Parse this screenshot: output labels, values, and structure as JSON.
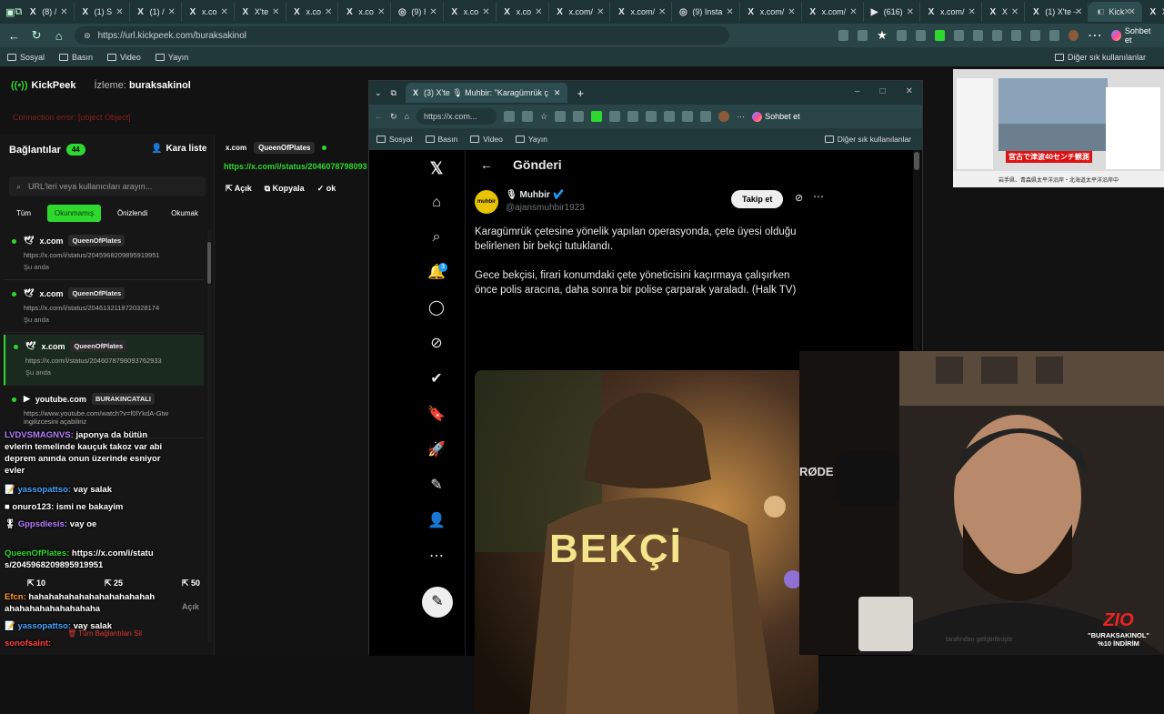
{
  "browser": {
    "tabs": [
      {
        "fav": "X",
        "label": "(8) /"
      },
      {
        "fav": "X",
        "label": "(1) S"
      },
      {
        "fav": "X",
        "label": "(1) /"
      },
      {
        "fav": "X",
        "label": "x.co"
      },
      {
        "fav": "X",
        "label": "X'te"
      },
      {
        "fav": "X",
        "label": "x.co"
      },
      {
        "fav": "X",
        "label": "x.co"
      },
      {
        "fav": "◎",
        "label": "(9) I"
      },
      {
        "fav": "X",
        "label": "x.co"
      },
      {
        "fav": "X",
        "label": "x.co"
      },
      {
        "fav": "X",
        "label": "x.com/"
      },
      {
        "fav": "X",
        "label": "x.com/"
      },
      {
        "fav": "◎",
        "label": "(9) Insta"
      },
      {
        "fav": "X",
        "label": "x.com/"
      },
      {
        "fav": "X",
        "label": "x.com/"
      },
      {
        "fav": "▶",
        "label": "(616)"
      },
      {
        "fav": "X",
        "label": "x.com/"
      },
      {
        "fav": "X",
        "label": "X"
      },
      {
        "fav": "X",
        "label": "(1) X'te"
      },
      {
        "fav": "◐",
        "label": "Kick"
      },
      {
        "fav": "X",
        "label": "X"
      }
    ],
    "url": "https://url.kickpeek.com/buraksakinol",
    "chat_label": "Sohbet et",
    "bookmarks": [
      "Sosyal",
      "Basın",
      "Video",
      "Yayın"
    ],
    "other_bookmarks": "Diğer sık kullanılanlar"
  },
  "kickpeek": {
    "logo": "KickPeek",
    "watching_label": "İzleme:",
    "watching_user": "buraksakinol",
    "error": "Connection error: [object Object]",
    "connections_title": "Bağlantılar",
    "connections_count": "44",
    "blacklist": "Kara liste",
    "search_placeholder": "URL'leri veya kullanıcıları arayın...",
    "filters": [
      "Tüm",
      "Okunmamış",
      "Önizlendi",
      "Okumak"
    ],
    "items": [
      {
        "site": "x.com",
        "user": "QueenOfPlates",
        "url": "https://x.com/i/status/2045968209895919951",
        "time": "Şu anda"
      },
      {
        "site": "x.com",
        "user": "QueenOfPlates",
        "url": "https://x.com/i/status/2046132118720328174",
        "time": "Şu anda"
      },
      {
        "site": "x.com",
        "user": "QueenOfPlates",
        "url": "https://x.com/i/status/2046078798093762933",
        "time": "Şu anda"
      },
      {
        "site": "youtube.com",
        "user": "BURAKINCATALI",
        "url": "https://www.youtube.com/watch?v=f0lYkdA-Gtw ingilizcesini açabiliriz",
        "time": ""
      }
    ],
    "bottom_counts": [
      "10",
      "25",
      "50"
    ],
    "open_label": "Açık",
    "delete_all": "Tüm Bağlantıları Sil",
    "selected": {
      "site": "x.com",
      "user": "QueenOfPlates",
      "url": "https://x.com/i/status/2046078798093",
      "open": "Açık",
      "copy": "Kopyala",
      "mark": "ok"
    }
  },
  "chat": [
    {
      "user": "LVDVSMAGNVS:",
      "color": "#b57dff",
      "msg": "japonya da bütün evlerin temelinde kauçuk takoz var abi deprem anında onun üzerinde esniyor evler"
    },
    {
      "user": "yassopattso:",
      "color": "#4aa3ff",
      "msg": "vay salak"
    },
    {
      "user": "onuro123:",
      "color": "#fff",
      "msg": "ismi ne bakayim"
    },
    {
      "user": "Gppsdiesis:",
      "color": "#b57dff",
      "msg": "vay oe"
    },
    {
      "user": "QueenOfPlates:",
      "color": "#2ed82e",
      "msg": "https://x.com/i/status/2045968209895919951"
    },
    {
      "user": "Efcn:",
      "color": "#ff9b2e",
      "msg": "hahahahahahahahahahahahahahahahahahahahahaha"
    },
    {
      "user": "yassopattso:",
      "color": "#4aa3ff",
      "msg": "vay salak"
    },
    {
      "user": "sonofsaint:",
      "color": "#ff4040",
      "msg": ""
    }
  ],
  "popup": {
    "tab_title": "(3) X'te 🎙 Muhbir: \"Karagümrük ç",
    "url": "https://x.com...",
    "chat_label": "Sohbet et",
    "bookmarks": [
      "Sosyal",
      "Basın",
      "Video",
      "Yayın"
    ],
    "other_bookmarks": "Diğer sık kullanılanlar",
    "post_header": "Gönderi",
    "author_name": "Muhbir",
    "author_handle": "@ajansmuhbir1923",
    "avatar_text": "muhbir",
    "follow": "Takip et",
    "notif_count": "3",
    "text1": "Karagümrük çetesine yönelik yapılan operasyonda, çete üyesi olduğu belirlenen bir bekçi tutuklandı.",
    "text2": "Gece bekçisi, firari konumdaki çete yöneticisini kaçırmaya çalışırken önce polis aracına, daha sonra bir polise çarparak yaraladı. (Halk TV)",
    "image_text": "BEKÇİ"
  },
  "news_thumb": {
    "banner": "宮古で津波40センチ観測",
    "ticker": "岩手県、青森県太平洋沿岸・北海道太平洋沿岸中"
  },
  "stream": {
    "brand": "ZIO",
    "promo": "\"BURAKSAKINOL\" %10 İNDİRİM",
    "mic_brand": "RØDE"
  },
  "footnote": "tarafından geliştirilmiştir"
}
